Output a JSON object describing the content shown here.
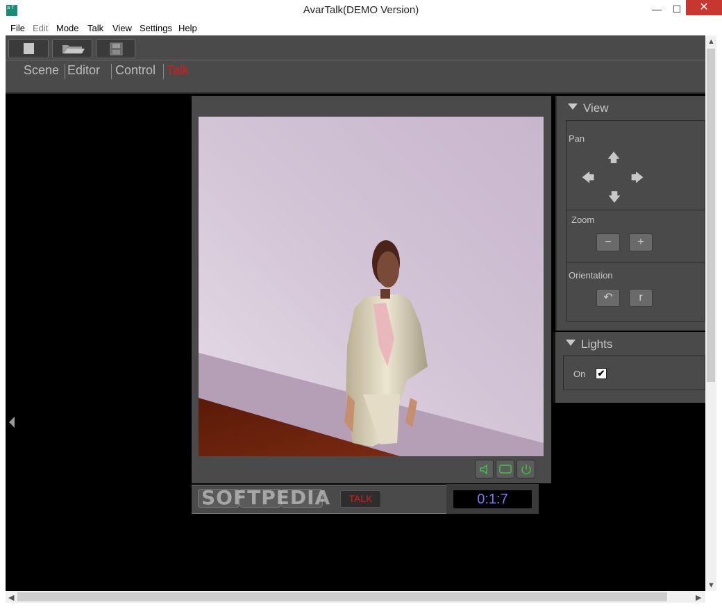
{
  "window": {
    "title": "AvarTalk(DEMO Version)",
    "icon": "app-icon",
    "icon_text": "a T"
  },
  "window_controls": {
    "minimize": "—",
    "maximize": "☐",
    "close": "✕"
  },
  "menu": [
    {
      "label": "File",
      "enabled": true
    },
    {
      "label": "Edit",
      "enabled": false
    },
    {
      "label": "Mode",
      "enabled": true
    },
    {
      "label": "Talk",
      "enabled": true
    },
    {
      "label": "View",
      "enabled": true
    },
    {
      "label": "Settings",
      "enabled": true
    },
    {
      "label": "Help",
      "enabled": true
    }
  ],
  "toolbar": {
    "buttons": [
      "new-icon",
      "open-folder-icon",
      "save-disk-icon"
    ]
  },
  "tabs": [
    {
      "label": "Scene",
      "active": false
    },
    {
      "label": "Editor",
      "active": false
    },
    {
      "label": "Control",
      "active": false
    },
    {
      "label": "Talk",
      "active": true
    }
  ],
  "viewer": {
    "controls": [
      "speaker-icon",
      "screen-icon",
      "power-icon"
    ],
    "talk_button": "TALK",
    "timer": "0:1:7",
    "watermark": "SOFTPEDIA",
    "accent": "#e01818",
    "timer_color": "#7a7aff"
  },
  "view_panel": {
    "title": "View",
    "pan": {
      "label": "Pan",
      "arrows": {
        "up": "🡅",
        "left": "🡄",
        "right": "🡆",
        "down": "🡇"
      }
    },
    "zoom": {
      "label": "Zoom",
      "out": "−",
      "in": "+"
    },
    "orientation": {
      "label": "Orientation",
      "rotate_left": "↶",
      "rotate_right": "r"
    }
  },
  "lights_panel": {
    "title": "Lights",
    "on_label": "On",
    "on_checked": true,
    "check": "✔"
  },
  "scroll": {
    "up": "▲",
    "down": "▼",
    "left": "◀",
    "right": "▶"
  }
}
